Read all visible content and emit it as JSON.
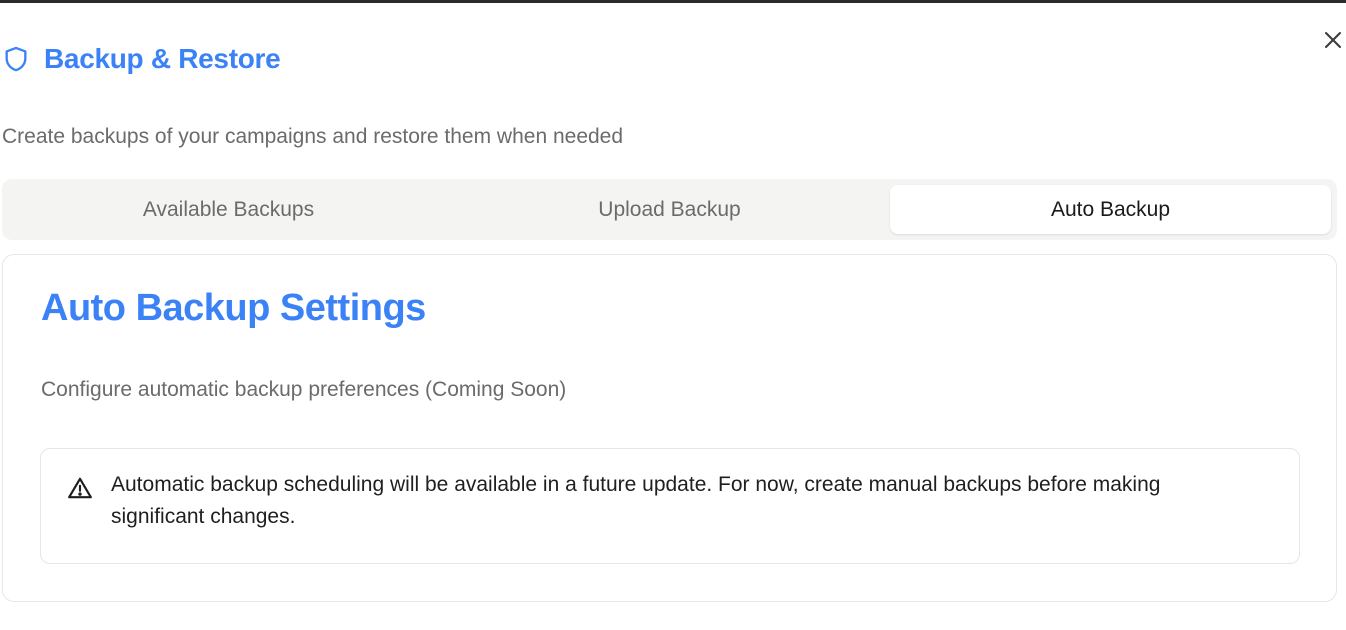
{
  "dialog": {
    "title": "Backup & Restore",
    "subtitle": "Create backups of your campaigns and restore them when needed",
    "title_icon": "shield-icon",
    "close_icon": "close-icon",
    "accent_color": "#3b82f6"
  },
  "tabs": [
    {
      "label": "Available Backups",
      "active": false
    },
    {
      "label": "Upload Backup",
      "active": false
    },
    {
      "label": "Auto Backup",
      "active": true
    }
  ],
  "panel": {
    "title": "Auto Backup Settings",
    "description": "Configure automatic backup preferences (Coming Soon)",
    "alert": {
      "icon": "warning-triangle-icon",
      "text": "Automatic backup scheduling will be available in a future update. For now, create manual backups before making significant changes."
    }
  }
}
